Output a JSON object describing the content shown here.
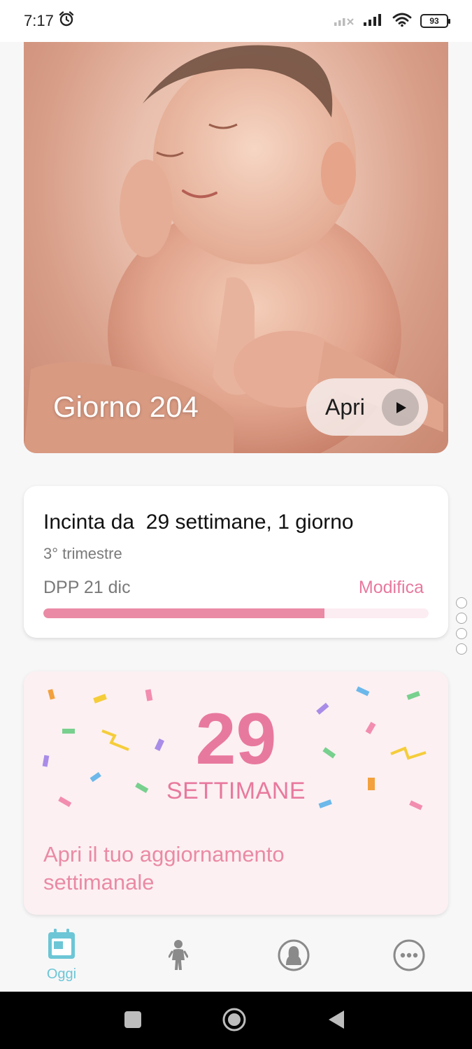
{
  "status_bar": {
    "time": "7:17",
    "battery": "93",
    "icons": [
      "alarm-icon",
      "signal-off-icon",
      "signal-icon",
      "wifi-icon",
      "battery-icon"
    ]
  },
  "hero": {
    "title": "Giorno 204",
    "button_label": "Apri",
    "icons": [
      "play-icon"
    ]
  },
  "pregnancy": {
    "title": "Incinta da  29 settimane, 1 giorno",
    "trimester": "3° trimestre",
    "due_date": "DPP 21 dic",
    "edit_label": "Modifica",
    "progress": 0.73,
    "colors": {
      "accent": "#e8799e",
      "track": "#fcedf2",
      "fill": "#ea8aa5"
    }
  },
  "weekly": {
    "number": "29",
    "unit": "SETTIMANE",
    "link": "Apri il tuo aggiornamento settimanale",
    "colors": {
      "background": "#fcf0f2",
      "text": "#e8799e"
    }
  },
  "bottom_nav": {
    "items": [
      {
        "label": "Oggi",
        "icon": "calendar-icon",
        "active": true
      },
      {
        "label": "",
        "icon": "baby-icon",
        "active": false
      },
      {
        "label": "",
        "icon": "community-icon",
        "active": false
      },
      {
        "label": "",
        "icon": "more-icon",
        "active": false
      }
    ],
    "active_color": "#6cc6d6",
    "inactive_color": "#8a8a8a"
  },
  "system_nav": {
    "icons": [
      "recents-icon",
      "home-icon",
      "back-icon"
    ]
  }
}
